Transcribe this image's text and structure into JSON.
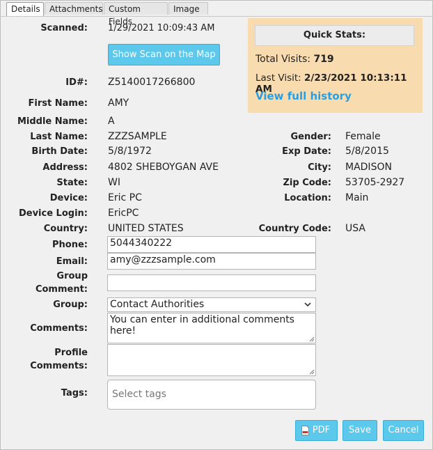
{
  "tabs": [
    {
      "label": "Details",
      "active": true
    },
    {
      "label": "Attachments",
      "active": false
    },
    {
      "label": "Custom Fields",
      "active": false
    },
    {
      "label": "Image",
      "active": false
    }
  ],
  "scanned": {
    "label": "Scanned:",
    "value": "1/29/2021 10:09:43 AM"
  },
  "map_button": "Show Scan on the Map",
  "quick_stats": {
    "title": "Quick Stats:",
    "total_visits_label": "Total Visits:",
    "total_visits_value": "719",
    "last_visit_label": "Last Visit:",
    "last_visit_value": "2/23/2021 10:13:11 AM",
    "history_link": "View full history",
    "bg_color": "#f8dcaf",
    "link_color": "#2a9ee0"
  },
  "fields": {
    "id": {
      "label": "ID#:",
      "value": "Z5140017266800"
    },
    "first_name": {
      "label": "First Name:",
      "value": "AMY"
    },
    "middle_name": {
      "label": "Middle Name:",
      "value": "A"
    },
    "last_name": {
      "label": "Last Name:",
      "value": "ZZZSAMPLE"
    },
    "gender": {
      "label": "Gender:",
      "value": "Female"
    },
    "birth_date": {
      "label": "Birth Date:",
      "value": "5/8/1972"
    },
    "exp_date": {
      "label": "Exp Date:",
      "value": "5/8/2015"
    },
    "address": {
      "label": "Address:",
      "value": "4802 SHEBOYGAN AVE"
    },
    "city": {
      "label": "City:",
      "value": "MADISON"
    },
    "state": {
      "label": "State:",
      "value": "WI"
    },
    "zip": {
      "label": "Zip Code:",
      "value": "53705-2927"
    },
    "device": {
      "label": "Device:",
      "value": "Eric PC"
    },
    "location": {
      "label": "Location:",
      "value": "Main"
    },
    "device_login": {
      "label": "Device Login:",
      "value": "EricPC"
    },
    "country": {
      "label": "Country:",
      "value": "UNITED STATES"
    },
    "country_code": {
      "label": "Country Code:",
      "value": "USA"
    }
  },
  "form": {
    "phone": {
      "label": "Phone:",
      "value": "5044340222"
    },
    "email": {
      "label": "Email:",
      "value": "amy@zzzsample.com"
    },
    "group_comment": {
      "label_line1": "Group",
      "label_line2": "Comment:",
      "value": ""
    },
    "group": {
      "label": "Group:",
      "selected": "Contact Authorities"
    },
    "comments": {
      "label": "Comments:",
      "value": "You can enter in additional comments here!"
    },
    "profile_comments": {
      "label_line1": "Profile",
      "label_line2": "Comments:",
      "value": ""
    },
    "tags": {
      "label": "Tags:",
      "placeholder": "Select tags"
    }
  },
  "buttons": {
    "pdf": "PDF",
    "save": "Save",
    "cancel": "Cancel",
    "accent_color": "#5bc8ec"
  }
}
